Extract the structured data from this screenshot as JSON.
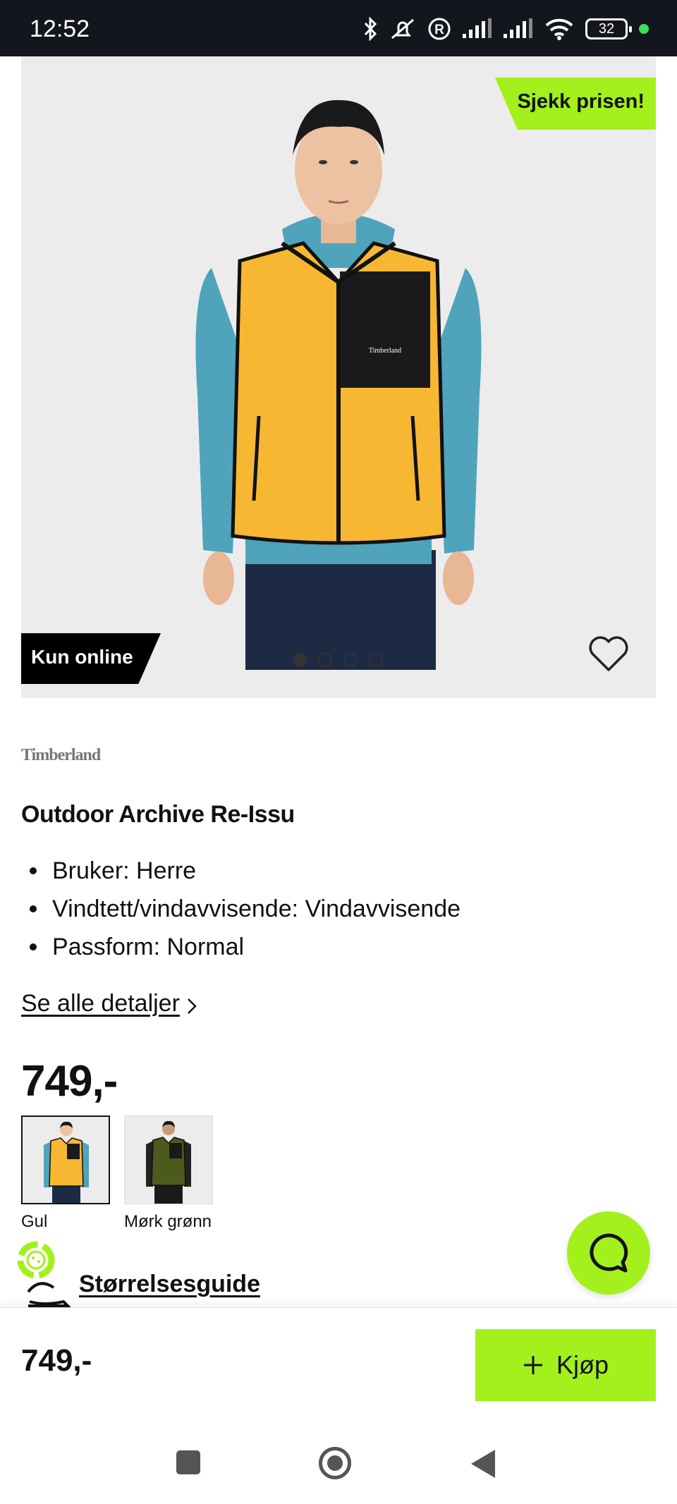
{
  "status_bar": {
    "time": "12:52",
    "battery": "32",
    "icons": [
      "bluetooth-icon",
      "mute-icon",
      "registered-icon",
      "signal-icon",
      "signal-icon",
      "wifi-icon",
      "battery-icon"
    ]
  },
  "product_image": {
    "promo_badge": "Sjekk prisen!",
    "online_badge": "Kun online",
    "image_count": 4,
    "active_image": 1
  },
  "product": {
    "brand": "Timberland",
    "title": "Outdoor Archive Re-Issu",
    "features": [
      "Bruker: Herre",
      "Vindtett/vindavvisende: Vindavvisende",
      "Passform: Normal"
    ],
    "details_link": "Se alle detaljer",
    "price": "749,-"
  },
  "variants": [
    {
      "label": "Gul",
      "selected": true
    },
    {
      "label": "Mørk grønn",
      "selected": false
    }
  ],
  "size_guide": "Størrelsesguide",
  "buy_bar": {
    "price": "749,-",
    "button_label": "Kjøp"
  },
  "colors": {
    "accent_green": "#a3f01c",
    "vest_yellow": "#f7b733",
    "status_bar": "#13161d"
  }
}
